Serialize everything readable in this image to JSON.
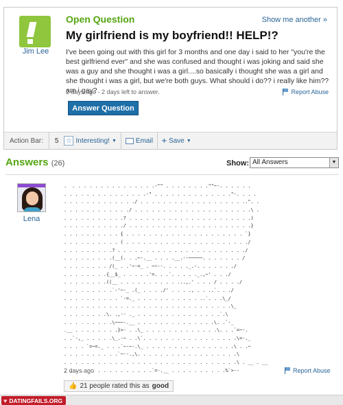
{
  "question": {
    "label": "Open Question",
    "show_another": "Show me another »",
    "user": "Jim Lee",
    "title": "My girlfriend is my boyfriend!! HELP!?",
    "body": "I've been going out with this girl for 3 months and one day i said to her \"you're the best girlfriend ever\" and she was confused and thought i was joking and said she was a guy and she thought i was a girl....so basically i thought she was a girl and she thought i was a girl, but we're both guys. What should i do?? i really like him?? am i gay?",
    "meta": "2 days ago - 2 days left to answer.",
    "report_abuse": "Report Abuse",
    "answer_button": "Answer Question",
    "icons": {
      "logo": "exclamation-logo-icon",
      "flag": "flag-icon"
    }
  },
  "action_bar": {
    "label": "Action Bar:",
    "count": "5",
    "interesting": "Interesting!",
    "email": "Email",
    "save": "Save",
    "icons": {
      "star": "star-icon",
      "email": "envelope-icon",
      "save": "plus-icon",
      "caret": "caret-down-icon"
    }
  },
  "answers": {
    "title": "Answers",
    "count": "(26)",
    "show_label": "Show:",
    "filter_value": "All Answers",
    "items": [
      {
        "user": "Lena",
        "ascii": [
          ".  . . . . . . . . . . . . . . .-\"\" . . . . . . . .\"\"~-. . . . . .",
          ". . . . . . . . . . . . . . .-\" . . . . . . . . . . . . . .\"-. . . .",
          ". . . . . . . . . . . . ./ . . . . . . . . . . . . . . . . . . ..\". .",
          ". . . . . . . . . . . ./ . . . . . . . . . . . . . . . . . . . . .\\ .",
          ". . . . . . . . . . .? . . . . . . . . . . . . . . . . . . . . . .)",
          ". . . . . . . . . . ./ . . . . . . . . . . . . . . . . . . . . . .}",
          ". . . . . . . . . . { . . . . . . . . . . . . . . . . . . . . . `}",
          ". . . . . . . . . . ( . . . . . . . . . . . . . . . . . . . . . ./",
          ". . . . . . . . .? . . . . . . . . . . . . . . . . . . . . . . ./",
          ". . . . . . . . .(__(. . .~-.__ . . . .__.--~~~~~. . . . . . . /",
          ". . . . . . . . /(_ . .'~-=_ . ~~--. . . . ._.-. . . . . . ./",
          ". . . . . . . .{__$_ . . . . .'=. . .`. . . . ._.,~' . . ./",
          ". . . . . . . .((__ . . . . . . . . . . ...,.' . . . / . . . ./",
          ". . . . . . . . .`-'~-_ .(_ . . . ./' . . . ., . . ..`. . ./",
          ". . . . . . . . . . `-=._ . . . . . . . . . . . ..`. . .\\_/",
          ". . . . . . . . . . . . . . . . . . . . . . . . . . . . . .\\_",
          ". . . . . . . .\\. .,-- ._ . . . . . . . . . . . . . . .`.\\",
          ". . . . . . . . .\\~~~-.__ . . . . . . . . . . . . . .\\. .`-_",
          ".__ . . . . . . . .}>- . .\\_ . . . . . . . . . . . . .\\. . .`=~-.",
          ". .`-,_ . . . . .\\_.-~ . .\\`. . . . . . . . . . . . . . . . .\\=-._",
          ". . . . `=~=._ . . .`~-~-.\\_ . . . . . . . . . . . . . . . .\\ . .~",
          ". . . . . . . . . .`~--.,\\. . . . . . . . . . . . . . . . . .\\",
          ". . . . . . . . . . . . . . . . . . . . . . . . . . . . . . .\\ . __ . __",
          ". . . . . . . . . . . . . . . .`=-.__ . . . . . . . . . .%`>--"
        ],
        "meta": "2 days ago",
        "report_abuse": "Report Abuse",
        "rating_prefix": "21 people rated this as",
        "rating_value": "good",
        "icons": {
          "avatar": "avatar-image",
          "thumb": "thumbs-up-icon"
        }
      }
    ]
  },
  "footer": {
    "brand": "DATINGFAILS.ORG",
    "icon": "heart-icon"
  },
  "colors": {
    "accent_green": "#54a511",
    "logo_green": "#8fc63d",
    "link_blue": "#2a6496",
    "button_blue": "#1e6fa8",
    "footer_red": "#c21d2a"
  }
}
